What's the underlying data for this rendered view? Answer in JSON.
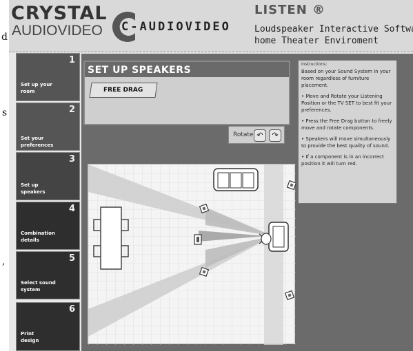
{
  "outside_text": [
    "d",
    "s",
    ","
  ],
  "header": {
    "logo_crystal": "CRYSTAL",
    "logo_audiovideo": "AUDIOVIDEO",
    "brand2": "C-AUDIOVIDEO",
    "app_title": "LISTEN ®",
    "subtitle_line1": "Loudspeaker Interactive Software fo",
    "subtitle_line2": "home Theater Enviroment"
  },
  "sidebar": {
    "steps": [
      {
        "num": "1",
        "label": "Set up your room"
      },
      {
        "num": "2",
        "label": "Set your preferences"
      },
      {
        "num": "3",
        "label": "Set up speakers"
      },
      {
        "num": "4",
        "label": "Combination details"
      },
      {
        "num": "5",
        "label": "Select sound system"
      },
      {
        "num": "6",
        "label": "Print design"
      }
    ],
    "active_step": 3
  },
  "panel": {
    "title": "SET UP SPEAKERS",
    "free_drag_label": "FREE DRAG",
    "rotate_label": "Rotate:",
    "rotate_left_icon": "rotate-left-icon",
    "rotate_right_icon": "rotate-right-icon"
  },
  "instructions": {
    "title": "Instructions:",
    "items": [
      "Based on your Sound System in your room regardless of furniture placement.",
      "• Move and Rotate your Listening Position or the TV SET to best fit your preferences.",
      "• Press the Free Drag button to freely move and rotate components.",
      "• Speakers will move simultaneously to provide the best quality of sound.",
      "• If a component is in an incorrect position it will turn red."
    ]
  },
  "colors": {
    "stage_bg": "#6b6b6b",
    "panel_bg": "#cfcfcf",
    "title_bar": "#6a6a6a",
    "sidebar_step": "#555555",
    "sound_beam": "#c8c8c8"
  }
}
